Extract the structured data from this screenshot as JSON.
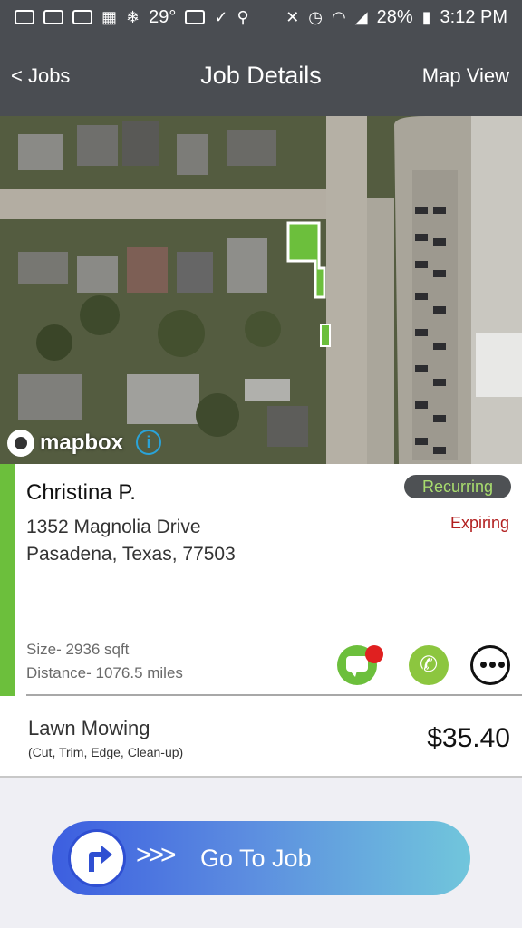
{
  "status_bar": {
    "temperature": "29°",
    "battery": "28%",
    "time": "3:12 PM"
  },
  "nav": {
    "back_label": "< Jobs",
    "title": "Job Details",
    "right_label": "Map View"
  },
  "map": {
    "attribution": "mapbox",
    "info_glyph": "i"
  },
  "job": {
    "customer_name": "Christina P.",
    "address_line1": "1352 Magnolia Drive",
    "address_line2": "Pasadena, Texas, 77503",
    "badge": "Recurring",
    "status": "Expiring",
    "size": "Size- 2936 sqft",
    "distance": "Distance- 1076.5 miles",
    "service_name": "Lawn Mowing",
    "service_details": "(Cut, Trim, Edge, Clean-up)",
    "price": "$35.40"
  },
  "actions": {
    "go_label": "Go To Job",
    "go_chevrons": ">>>",
    "phone_glyph": "✆"
  },
  "colors": {
    "accent_green": "#6cbf3c",
    "bar": "#4a4d52",
    "expiring_red": "#b21f1f",
    "badge_text": "#a8dc6e"
  },
  "icons": [
    "chat-icon",
    "phone-icon",
    "more-icon",
    "navigate-arrow-icon",
    "mapbox-logo-icon",
    "info-icon"
  ]
}
